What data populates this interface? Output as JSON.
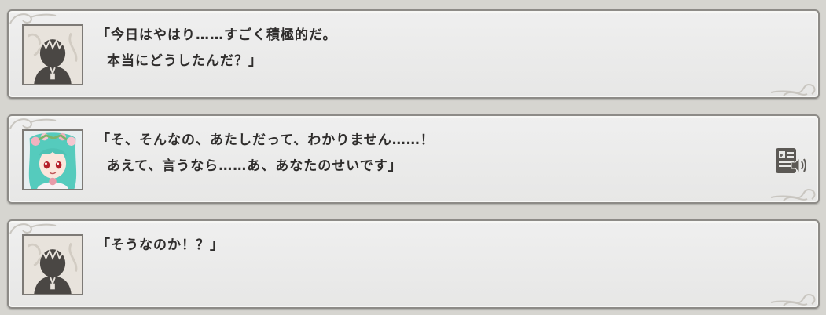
{
  "backlog": [
    {
      "speaker_portrait": "protagonist-silhouette",
      "line1": "「今日はやはり……すごく積極的だ。",
      "line2": "本当にどうしたんだ？」",
      "has_voice": false
    },
    {
      "speaker_portrait": "green-haired-girl",
      "line1": "「そ、そんなの、あたしだって、わかりません……！",
      "line2": "あえて、言うなら……あ、あなたのせいです」",
      "has_voice": true
    },
    {
      "speaker_portrait": "protagonist-silhouette",
      "line1": "「そうなのか！？」",
      "line2": "",
      "has_voice": false
    }
  ],
  "colors": {
    "panel_bg": "#ebebea",
    "border": "#8d8b87",
    "text": "#2f2d2c",
    "page_bg": "#d6d5d0"
  }
}
